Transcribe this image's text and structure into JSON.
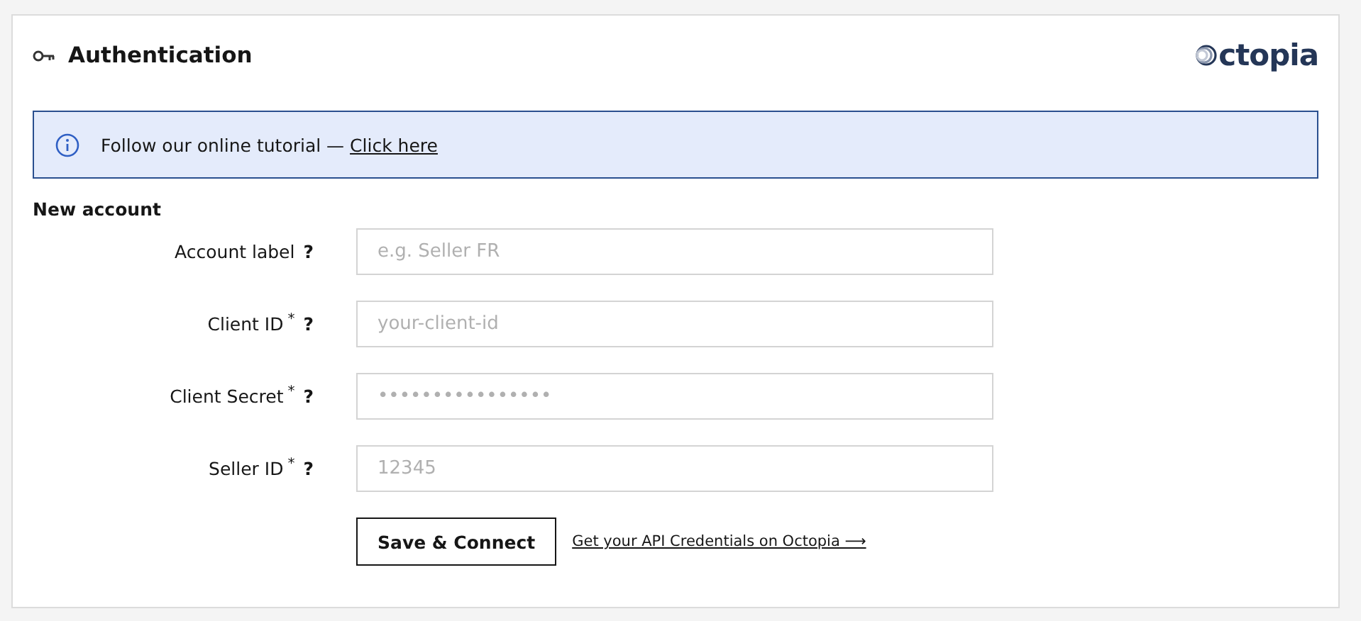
{
  "header": {
    "title": "Authentication",
    "logo": "ctopia"
  },
  "banner": {
    "text": "Follow our online tutorial — ",
    "link": "Click here"
  },
  "section_title": "New account",
  "fields": [
    {
      "label": "Account label",
      "help": "?",
      "placeholder": "e.g. Seller FR"
    },
    {
      "label": "Client ID",
      "required_mark": "*",
      "help": "?",
      "placeholder": "your-client-id"
    },
    {
      "label": "Client Secret",
      "required_mark": "*",
      "help": "?",
      "placeholder": "••••••••••••••••"
    },
    {
      "label": "Seller ID",
      "required_mark": "*",
      "help": "?",
      "placeholder": "12345"
    }
  ],
  "submit_button": "Save & Connect",
  "credentials_link": "Get your API Credentials on Octopia ⟶"
}
